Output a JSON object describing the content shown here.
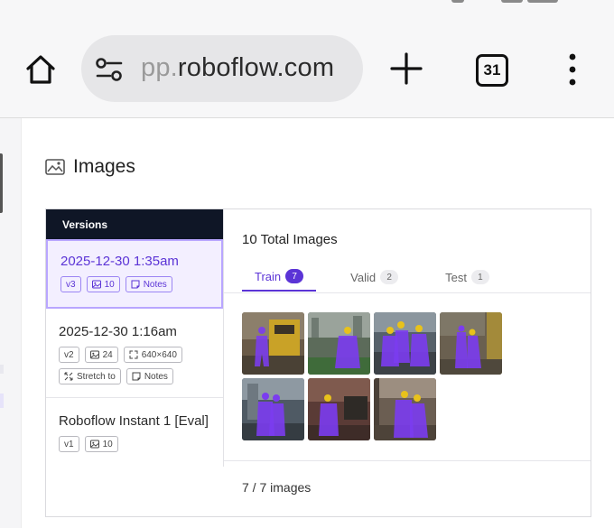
{
  "browser": {
    "url_faded": "pp.",
    "url_main": "roboflow.com",
    "tab_count": "31"
  },
  "section": {
    "title": "Images"
  },
  "versions": {
    "header": "Versions",
    "items": [
      {
        "date": "2025-12-30 1:35am",
        "active": true,
        "tags": [
          {
            "icon": "none",
            "text": "v3"
          },
          {
            "icon": "image-icon",
            "text": "10"
          },
          {
            "icon": "notes-icon",
            "text": "Notes"
          }
        ]
      },
      {
        "date": "2025-12-30 1:16am",
        "active": false,
        "tags": [
          {
            "icon": "none",
            "text": "v2"
          },
          {
            "icon": "image-icon",
            "text": "24"
          },
          {
            "icon": "resize-icon",
            "text": "640×640"
          },
          {
            "icon": "stretch-icon",
            "text": "Stretch to"
          },
          {
            "icon": "notes-icon",
            "text": "Notes"
          }
        ]
      },
      {
        "date": "Roboflow Instant 1 [Eval]",
        "active": false,
        "tags": [
          {
            "icon": "none",
            "text": "v1"
          },
          {
            "icon": "image-icon",
            "text": "10"
          }
        ]
      }
    ]
  },
  "main": {
    "total_label": "10 Total Images",
    "tabs": [
      {
        "label": "Train",
        "count": "7",
        "active": true
      },
      {
        "label": "Valid",
        "count": "2",
        "active": false
      },
      {
        "label": "Test",
        "count": "1",
        "active": false
      }
    ],
    "footer": "7 / 7 images"
  },
  "colors": {
    "accent": "#5b34d6",
    "mask": "#7b3cf0",
    "header_dark": "#0f1626"
  }
}
